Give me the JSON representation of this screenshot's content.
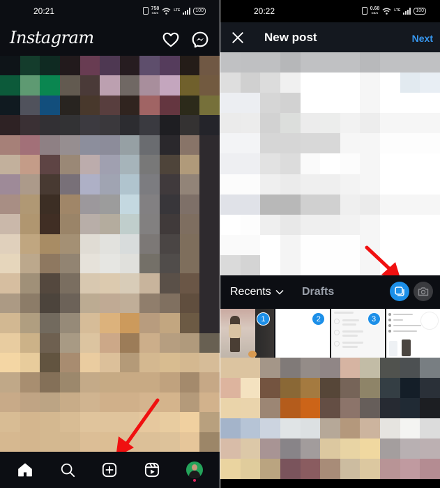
{
  "left_screen": {
    "status_bar": {
      "time": "20:21",
      "net_speed": "758",
      "net_unit": "KB/S",
      "network_label": "LTE",
      "battery": "100"
    },
    "header": {
      "logo": "Instagram",
      "icons": [
        "heart-icon",
        "messenger-icon"
      ]
    },
    "feed_mosaic_colors": [
      [
        "#0e1418",
        "#143c2c",
        "#0f2a22",
        "#221a1c",
        "#683c52",
        "#4e3852",
        "#261c20",
        "#5e4e6c",
        "#553c5c",
        "#241c18",
        "#705844"
      ],
      [
        "#0c5a3a",
        "#5e9a72",
        "#0a8650",
        "#625a50",
        "#4a3a38",
        "#bca0b0",
        "#706864",
        "#a88e9c",
        "#c4a6be",
        "#70602c",
        "#725a40"
      ],
      [
        "#101a20",
        "#50525c",
        "#124e7c",
        "#282420",
        "#48382c",
        "#583e3e",
        "#30241f",
        "#a06464",
        "#643640",
        "#2c2a1a",
        "#76703a"
      ],
      [
        "#2e2224",
        "#3a3034",
        "#323034",
        "#323234",
        "#3c3a40",
        "#3a383c",
        "#2c2c30",
        "#3a3a40",
        "#1e1e22",
        "#343232",
        "#24242a"
      ],
      [
        "#a68078",
        "#a27078",
        "#8e8084",
        "#968e90",
        "#8c8e9c",
        "#8c8c9a",
        "#96a0a4",
        "#6a6c70",
        "#2a282c",
        "#887468",
        "#2e2a2e"
      ],
      [
        "#c2b09c",
        "#c49c88",
        "#5e4444",
        "#9a8876",
        "#bcacac",
        "#a0a0b0",
        "#a6b4ba",
        "#787878",
        "#4e443a",
        "#b09a7a",
        "#2e2a2e"
      ],
      [
        "#9e8a98",
        "#ac9a8a",
        "#483a32",
        "#787078",
        "#aeb0c6",
        "#a0a4b2",
        "#b0c4ce",
        "#7c7c80",
        "#403a3c",
        "#928478",
        "#2e2a2e"
      ],
      [
        "#a88e84",
        "#b09874",
        "#3c2e24",
        "#a08668",
        "#9c989c",
        "#9c9c9c",
        "#c4d8e0",
        "#828082",
        "#38363a",
        "#7e7068",
        "#2e2a2e"
      ],
      [
        "#cab8aa",
        "#b09670",
        "#402e24",
        "#9a8468",
        "#b8aea8",
        "#b4ac9e",
        "#c0cecc",
        "#828080",
        "#403a3a",
        "#7e6e60",
        "#2e2a2e"
      ],
      [
        "#e0d0bc",
        "#c0a680",
        "#a88c64",
        "#a49074",
        "#e0dcd4",
        "#e2e2de",
        "#d8dcdc",
        "#7c7876",
        "#4a4544",
        "#7e6e5c",
        "#2e2a2e"
      ],
      [
        "#e6d6bc",
        "#bca88c",
        "#8e7860",
        "#928472",
        "#e6e2da",
        "#e6e6e2",
        "#e0e0dc",
        "#747068",
        "#504c4a",
        "#7e6e5c",
        "#2e2a2e"
      ],
      [
        "#d6bea0",
        "#a09078",
        "#54483e",
        "#7a6e60",
        "#d8c8b0",
        "#dccaaf",
        "#d8ccb8",
        "#c8b49c",
        "#5a5048",
        "#6a5646",
        "#2e2a2e"
      ],
      [
        "#ac9a84",
        "#8c7c68",
        "#4c443c",
        "#6c6258",
        "#bcab92",
        "#c0aa94",
        "#c0ae98",
        "#907e6c",
        "#807060",
        "#604e3e",
        "#2e2a2e"
      ],
      [
        "#d2b892",
        "#b09e80",
        "#726a5e",
        "#968a78",
        "#d6bc98",
        "#dcb27c",
        "#cc9a5c",
        "#b89c7e",
        "#c2a680",
        "#6c5a44",
        "#2e2a2e"
      ],
      [
        "#e8cca0",
        "#ccb288",
        "#6e6050",
        "#a89a84",
        "#dcc4a0",
        "#cca888",
        "#9c7c58",
        "#ccae8a",
        "#b69e80",
        "#b09a7c",
        "#686052"
      ],
      [
        "#f4d6a4",
        "#e8cc9c",
        "#625440",
        "#a88c70",
        "#eaccA0",
        "#dcc09a",
        "#b49a78",
        "#d4b890",
        "#d8bc90",
        "#d4b890",
        "#d6bc98"
      ],
      [
        "#c0a888",
        "#a88e70",
        "#847058",
        "#9c886c",
        "#c4aa88",
        "#c6aa84",
        "#c8aa84",
        "#c8aa84",
        "#c0a27e",
        "#a48a6c",
        "#c6a886"
      ],
      [
        "#c8aa88",
        "#c0a484",
        "#bca484",
        "#c8ac88",
        "#d0b490",
        "#d0b08a",
        "#d0b08a",
        "#d4b48e",
        "#d4b48c",
        "#b49a7a",
        "#d2b28c"
      ],
      [
        "#d8bc94",
        "#d4b68e",
        "#d4b890",
        "#d8bc94",
        "#e0c49c",
        "#e0c49c",
        "#e0c49c",
        "#e6c89e",
        "#e8cca0",
        "#f0d0a0",
        "#b8a07e"
      ],
      [
        "#d6b890",
        "#d4b68e",
        "#d4b890",
        "#d4b890",
        "#dcbe96",
        "#dcbe94",
        "#dcbe96",
        "#dcc098",
        "#ddc29a",
        "#e6c69a",
        "#9c8668"
      ]
    ],
    "bottom_nav": [
      {
        "name": "home",
        "icon": "home-icon",
        "active": true
      },
      {
        "name": "search",
        "icon": "search-icon",
        "active": false
      },
      {
        "name": "create",
        "icon": "plus-square-icon",
        "active": false
      },
      {
        "name": "reels",
        "icon": "reels-icon",
        "active": false
      },
      {
        "name": "profile",
        "icon": "avatar",
        "active": false
      }
    ]
  },
  "right_screen": {
    "status_bar": {
      "time": "20:22",
      "net_speed": "0.68",
      "net_unit": "KB/S",
      "network_label": "LTE",
      "battery": "100"
    },
    "header": {
      "title": "New post",
      "next_label": "Next",
      "close_icon": "close-icon"
    },
    "preview_mosaic_colors": [
      [
        "#c0c1c3",
        "#bfc0c2",
        "#bfc0c2",
        "#b6b7b9",
        "#c0c1c3",
        "#c0c1c3",
        "#c0c1c3",
        "#b8b9bb",
        "#c0c1c3",
        "#c0c1c3",
        "#c0c1c3"
      ],
      [
        "#dedede",
        "#d0d0d0",
        "#dcdcdc",
        "#f0f0f0",
        "#ffffff",
        "#ffffff",
        "#ffffff",
        "#f6f6f6",
        "#ffffff",
        "#e2eaf0",
        "#e8eef4"
      ],
      [
        "#eceef2",
        "#eceef2",
        "#d6d6d6",
        "#d2d2d2",
        "#ffffff",
        "#ffffff",
        "#ffffff",
        "#f6f6f6",
        "#ffffff",
        "#ffffff",
        "#ffffff"
      ],
      [
        "#ebebeb",
        "#ececec",
        "#d2d2d2",
        "#dcdedc",
        "#ececec",
        "#ecedec",
        "#f2f2f2",
        "#ededed",
        "#f6f6f6",
        "#f6f6f6",
        "#f6f6f6"
      ],
      [
        "#f3f4f6",
        "#f3f4f6",
        "#d6d6d6",
        "#d6d6d6",
        "#d8d8d8",
        "#d8d8d8",
        "#f6f6f6",
        "#f6f6f6",
        "#fdfdfd",
        "#fdfdfd",
        "#fdfdfd"
      ],
      [
        "#eeeff2",
        "#eeeff2",
        "#e2e2e2",
        "#dcdcdc",
        "#fafafa",
        "#ffffff",
        "#fcfcfc",
        "#f6f6f6",
        "#ffffff",
        "#ffffff",
        "#ffffff"
      ],
      [
        "#fcfcfc",
        "#fcfcfc",
        "#efefef",
        "#ebebeb",
        "#efefef",
        "#efefef",
        "#f3f3f3",
        "#f6f6f6",
        "#ffffff",
        "#ffffff",
        "#ffffff"
      ],
      [
        "#e0e2e8",
        "#e0e2e8",
        "#b8b8b8",
        "#b8b8b8",
        "#d0d0d0",
        "#d0d0d0",
        "#efefef",
        "#ebebeb",
        "#f6f6f6",
        "#f6f6f6",
        "#f6f6f6"
      ],
      [
        "#ffffff",
        "#fdfdfd",
        "#efefef",
        "#e8e8e8",
        "#efefef",
        "#efefef",
        "#f2f2f2",
        "#f6f6f6",
        "#ffffff",
        "#ffffff",
        "#ffffff"
      ],
      [
        "#fafafa",
        "#fafafa",
        "#ffffff",
        "#f4f4f4",
        "#fefefe",
        "#fefefe",
        "#fefefe",
        "#f6f6f6",
        "#ffffff",
        "#ffffff",
        "#ffffff"
      ],
      [
        "#dadada",
        "#d4d4d4",
        "#ffffff",
        "#f4f4f4",
        "#fefefe",
        "#fefefe",
        "#fefefe",
        "#f6f6f6",
        "#ffffff",
        "#ffffff",
        "#ffffff"
      ]
    ],
    "gallery_tabs": {
      "recents_label": "Recents",
      "drafts_label": "Drafts"
    },
    "gallery_actions": {
      "multi_select_icon": "multi-select-icon",
      "camera_icon": "camera-icon",
      "multi_select_active": true
    },
    "selected_thumbnails": [
      {
        "order": "1",
        "kind": "photo"
      },
      {
        "order": "2",
        "kind": "blank"
      },
      {
        "order": "3",
        "kind": "screenshot-checkins"
      },
      {
        "order": "",
        "kind": "screenshot-profile-info"
      }
    ],
    "gallery_mosaic_colors": [
      [
        "#dcc4a0",
        "#dcc4a0",
        "#a49688",
        "#807a78",
        "#948c88",
        "#908686",
        "#d6b4a2",
        "#c2bca6",
        "#50524e",
        "#4c5052",
        "#787e82"
      ],
      [
        "#ddb49e",
        "#f4e2c0",
        "#745440",
        "#8a6836",
        "#a47a40",
        "#564638",
        "#766458",
        "#8e8468",
        "#343e44",
        "#141e28",
        "#2a3038"
      ],
      [
        "#ead4aa",
        "#ead4ac",
        "#9c8674",
        "#b45c1c",
        "#cc6418",
        "#644e44",
        "#8c746a",
        "#665e5a",
        "#262a32",
        "#202a34",
        "#1c1e22"
      ],
      [
        "#a4b4ca",
        "#b6c4d6",
        "#ccd4e0",
        "#e0e4e6",
        "#dce0e2",
        "#b6a898",
        "#b4987c",
        "#ccb49e",
        "#e6e4e0",
        "#f4f4f2",
        "#dcdcdc"
      ],
      [
        "#d8bca8",
        "#dcc8a8",
        "#a89494",
        "#888488",
        "#a29c9c",
        "#dcc8a0",
        "#e8d4a4",
        "#f0d8a0",
        "#a49e9e",
        "#b8b0b2",
        "#bcb0b2"
      ],
      [
        "#ead4a0",
        "#e0cc9c",
        "#baa480",
        "#7a545c",
        "#8a5c60",
        "#a88c78",
        "#ccbca0",
        "#dcc8a0",
        "#b89496",
        "#c09aa0",
        "#b48c92"
      ]
    ]
  }
}
